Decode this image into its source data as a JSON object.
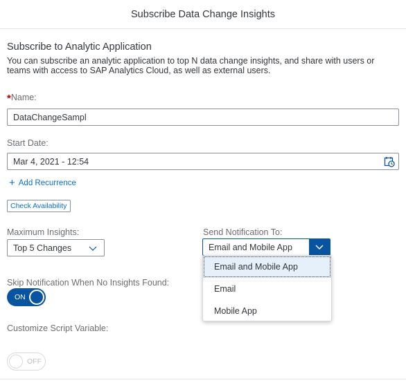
{
  "dialog": {
    "title": "Subscribe Data Change Insights"
  },
  "section": {
    "title": "Subscribe to Analytic Application",
    "description": "You can subscribe an analytic application to top N data change insights, and share with users or teams with access to SAP Analytics Cloud, as well as external users."
  },
  "name": {
    "required_marker": "*",
    "label": "Name:",
    "value": "DataChangeSampl"
  },
  "start_date": {
    "label": "Start Date:",
    "value": "Mar 4, 2021 - 12:54",
    "icon": "calendar-clock-icon"
  },
  "recurrence": {
    "label": "Add Recurrence",
    "icon": "plus-icon"
  },
  "availability": {
    "label": "Check Availability"
  },
  "max_insights": {
    "label": "Maximum Insights:",
    "value": "Top 5 Changes"
  },
  "send_notification": {
    "label": "Send Notification To:",
    "value": "Email and Mobile App",
    "options": [
      "Email and Mobile App",
      "Email",
      "Mobile App"
    ],
    "selected_index": 0
  },
  "skip_notification": {
    "label": "Skip Notification When No Insights Found:",
    "state": "ON"
  },
  "customize_script": {
    "label": "Customize Script Variable:",
    "state": "OFF"
  },
  "colors": {
    "accent": "#0854a0",
    "link": "#0a6ed1",
    "required": "#bb0000"
  }
}
